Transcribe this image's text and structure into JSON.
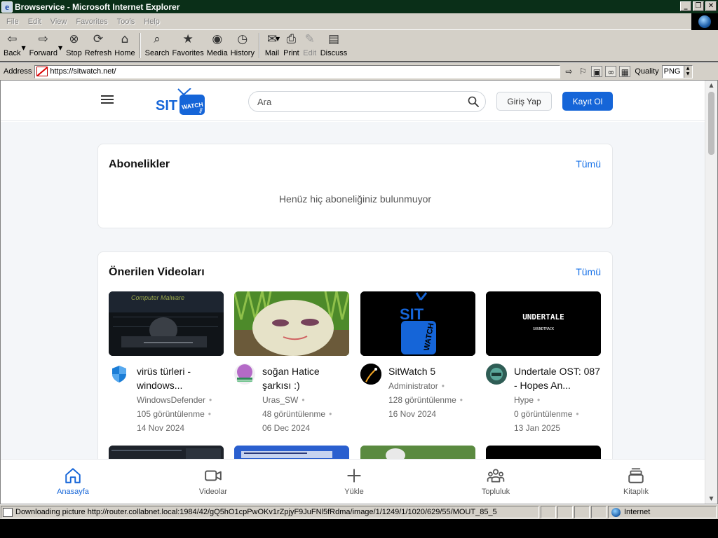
{
  "window": {
    "title": "Browservice - Microsoft Internet Explorer",
    "controls": [
      "_",
      "❐",
      "✕"
    ]
  },
  "menu": [
    "File",
    "Edit",
    "View",
    "Favorites",
    "Tools",
    "Help"
  ],
  "toolbar": {
    "back": "Back",
    "forward": "Forward",
    "stop": "Stop",
    "refresh": "Refresh",
    "home": "Home",
    "search": "Search",
    "favorites": "Favorites",
    "media": "Media",
    "history": "History",
    "mail": "Mail",
    "print": "Print",
    "edit": "Edit",
    "discuss": "Discuss"
  },
  "address": {
    "label": "Address",
    "url": "https://sitwatch.net/",
    "quality_label": "Quality",
    "quality_value": "PNG"
  },
  "site": {
    "logo_text": "SIT",
    "logo_tv_text": "WATCH",
    "logo_badge": ".net",
    "search_placeholder": "Ara",
    "login_label": "Giriş Yap",
    "signup_label": "Kayıt Ol",
    "brand_color": "#1565d8"
  },
  "subscriptions": {
    "title": "Abonelikler",
    "all_label": "Tümü",
    "empty_text": "Henüz hiç aboneliğiniz bulunmuyor"
  },
  "recommended": {
    "title": "Önerilen Videoları",
    "all_label": "Tümü",
    "videos": [
      {
        "title": "virüs türleri - windows...",
        "channel": "WindowsDefender",
        "views": "105 görüntülenme",
        "date": "14 Nov 2024",
        "thumb_text": "Computer Malware"
      },
      {
        "title": "soğan Hatice şarkısı :)",
        "channel": "Uras_SW",
        "views": "48 görüntülenme",
        "date": "06 Dec 2024",
        "thumb_text": ""
      },
      {
        "title": "SitWatch 5",
        "channel": "Administrator",
        "views": "128 görüntülenme",
        "date": "16 Nov 2024",
        "thumb_text": "WATCH"
      },
      {
        "title": "Undertale OST: 087 - Hopes An...",
        "channel": "Hype",
        "views": "0 görüntülenme",
        "date": "13 Jan 2025",
        "thumb_text": "UNDERTALE",
        "thumb_subtext": "SOUNDTRACK"
      }
    ]
  },
  "bottom_nav": {
    "home": "Anasayfa",
    "videos": "Videolar",
    "upload": "Yükle",
    "community": "Topluluk",
    "library": "Kitaplık"
  },
  "status": {
    "text": "Downloading picture http://router.collabnet.local:1984/42/gQ5hO1cpPwOKv1rZpjyF9JuFNl5fRdma/image/1/1249/1/1020/629/55/MOUT_85_5",
    "zone": "Internet"
  }
}
